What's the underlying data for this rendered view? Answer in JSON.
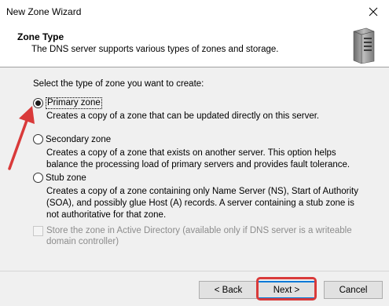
{
  "window": {
    "title": "New Zone Wizard",
    "close_icon": "close-icon"
  },
  "header": {
    "title": "Zone Type",
    "subtitle": "The DNS server supports various types of zones and storage.",
    "icon": "server-icon"
  },
  "content": {
    "prompt": "Select the type of zone you want to create:",
    "options": [
      {
        "label": "Primary zone",
        "selected": true,
        "description": "Creates a copy of a zone that can be updated directly on this server."
      },
      {
        "label": "Secondary zone",
        "selected": false,
        "description": "Creates a copy of a zone that exists on another server. This option helps balance the processing load of primary servers and provides fault tolerance."
      },
      {
        "label": "Stub zone",
        "selected": false,
        "description": "Creates a copy of a zone containing only Name Server (NS), Start of Authority (SOA), and possibly glue Host (A) records. A server containing a stub zone is not authoritative for that zone."
      }
    ],
    "ad_checkbox": {
      "label": "Store the zone in Active Directory (available only if DNS server is a writeable domain controller)",
      "checked": false,
      "enabled": false
    }
  },
  "footer": {
    "back_label": "< Back",
    "next_label": "Next >",
    "cancel_label": "Cancel"
  },
  "annotations": {
    "highlight_color": "#d93a3a"
  }
}
